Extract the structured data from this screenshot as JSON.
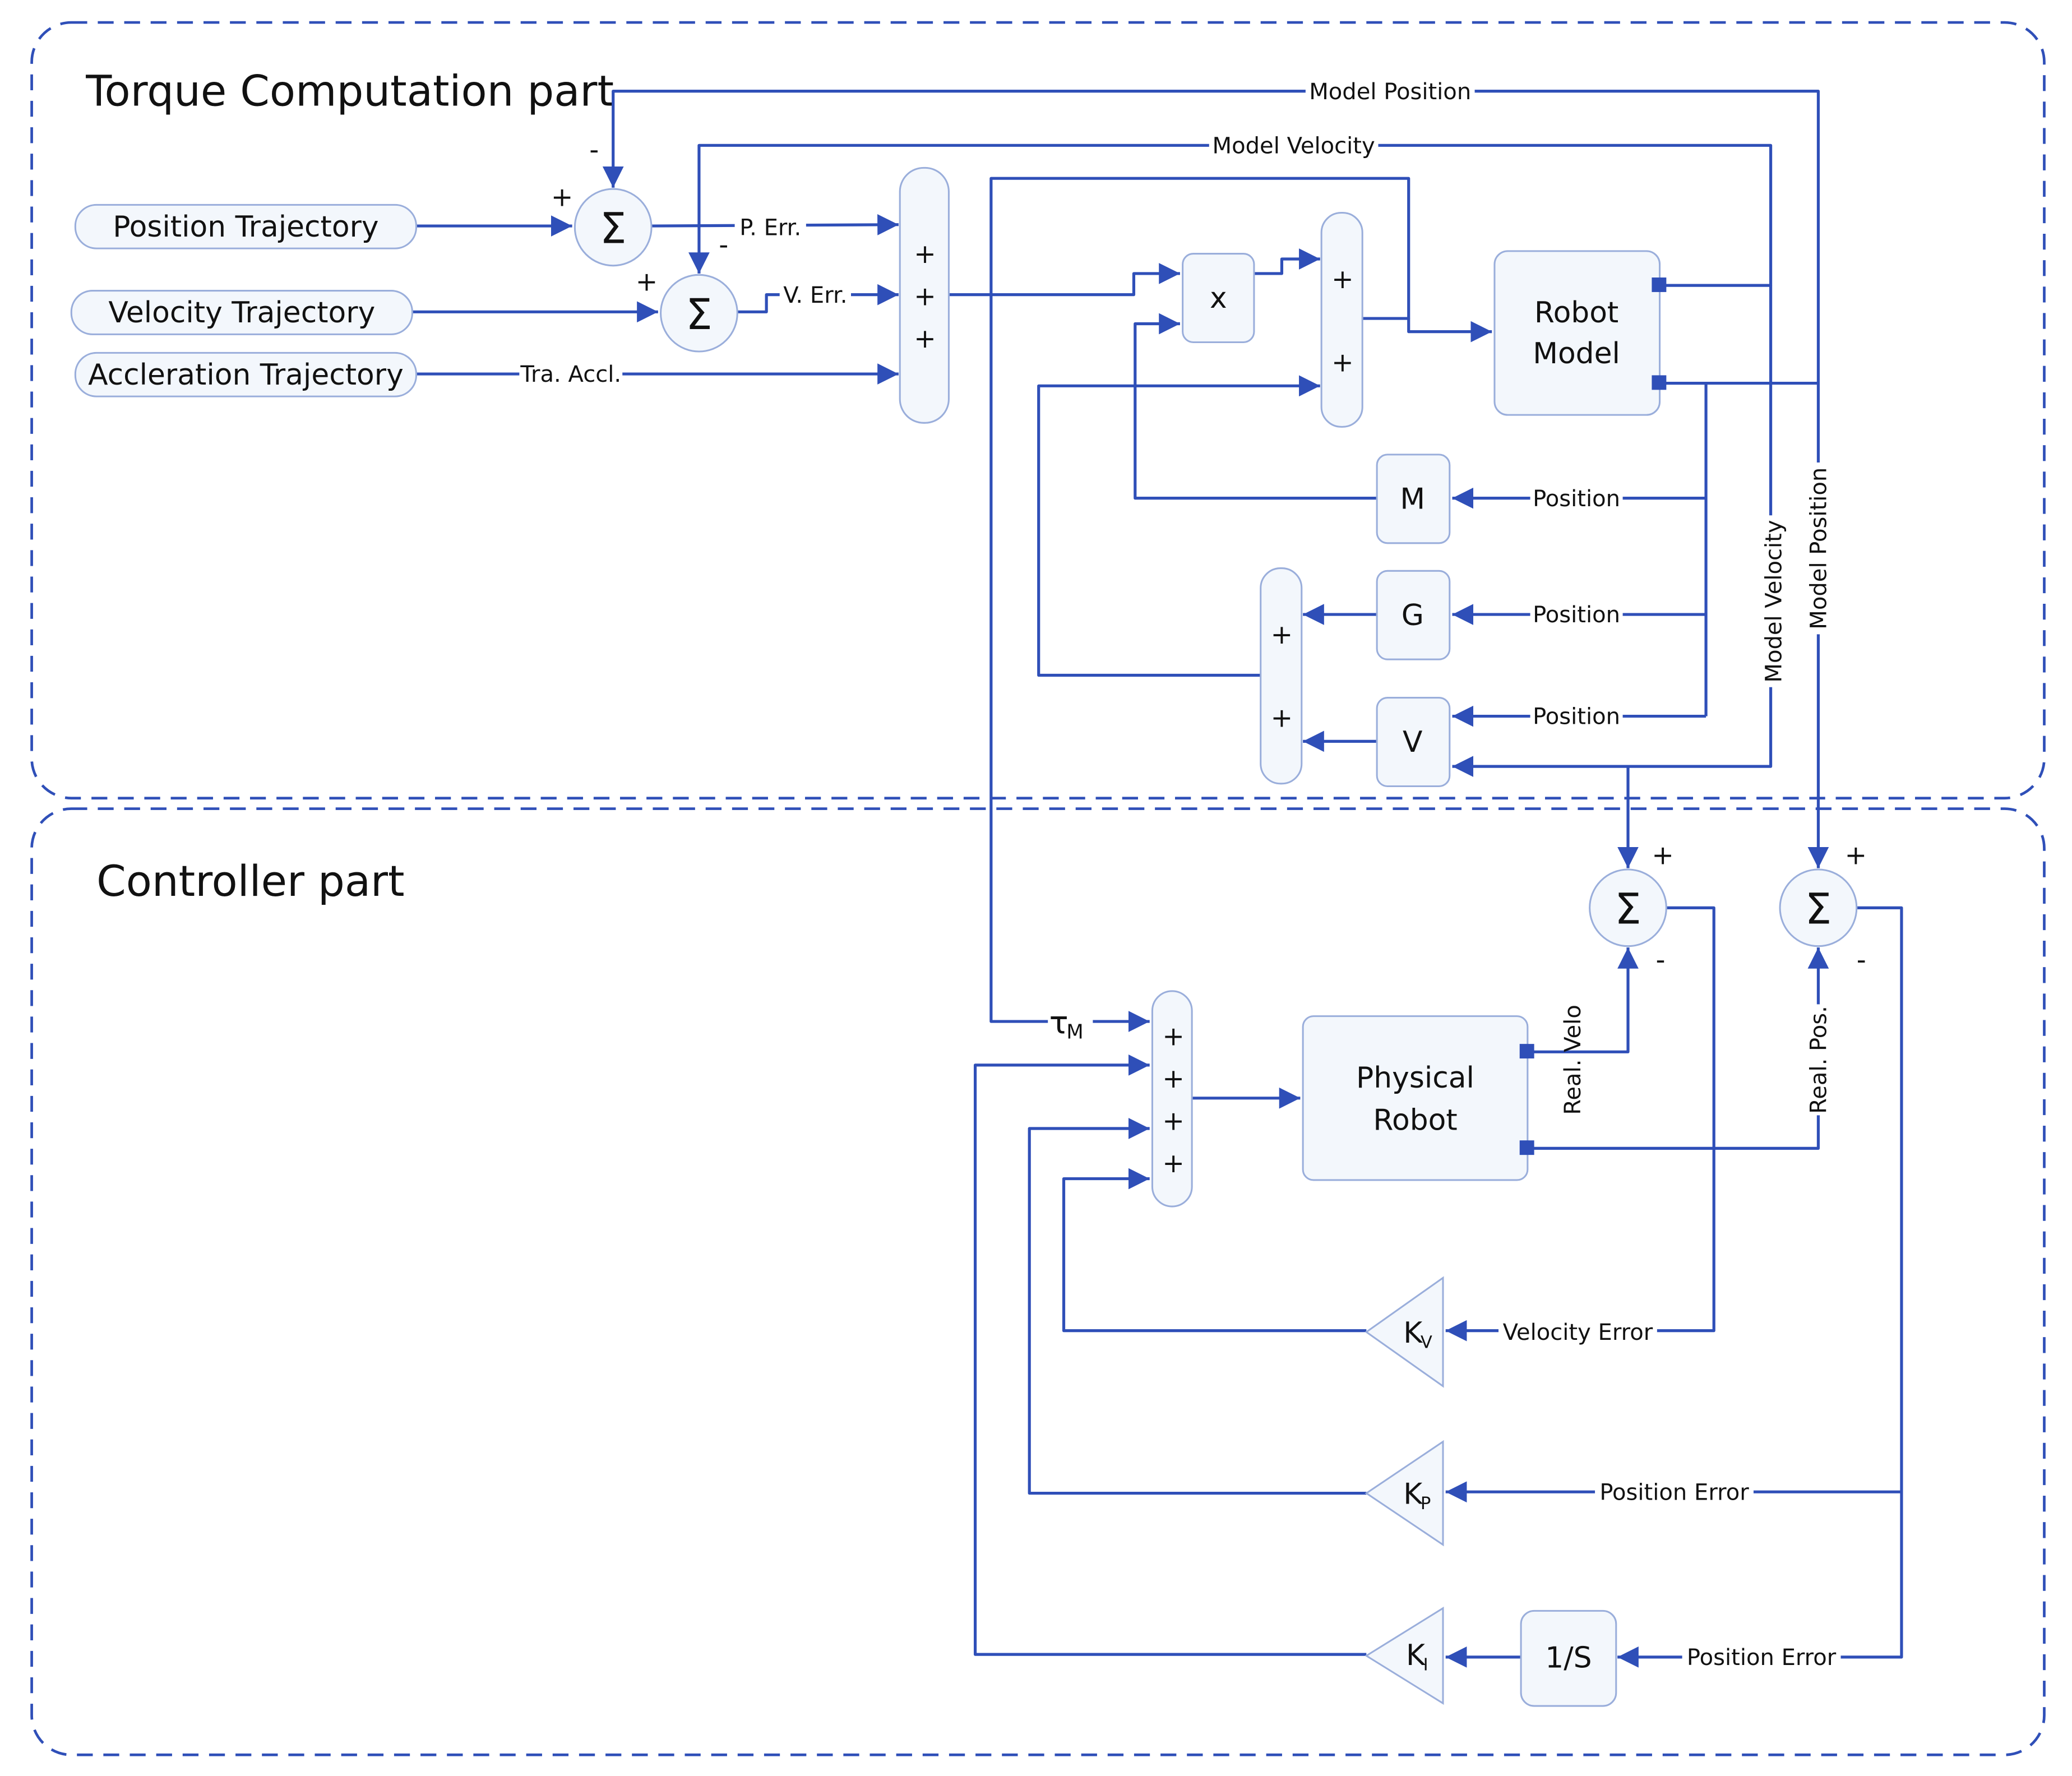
{
  "colors": {
    "line": "#2f4fb8",
    "block_fill": "#f3f7fc",
    "block_stroke": "#9aaedb"
  },
  "groups": {
    "torque_title": "Torque Computation part",
    "controller_title": "Controller part"
  },
  "inputs": {
    "position": "Position Trajectory",
    "velocity": "Velocity Trajectory",
    "acceleration": "Accleration Trajectory"
  },
  "blocks": {
    "sum_symbol": "Σ",
    "multiply": "x",
    "robot_model_1": "Robot",
    "robot_model_2": "Model",
    "m": "M",
    "g": "G",
    "v": "V",
    "physical_robot_1": "Physical",
    "physical_robot_2": "Robot",
    "kv": "K",
    "kv_sub": "V",
    "kp": "K",
    "kp_sub": "P",
    "ki": "K",
    "ki_sub": "I",
    "integrator": "1/S",
    "plus": "+",
    "minus": "-"
  },
  "signals": {
    "model_position": "Model Position",
    "model_velocity": "Model Velocity",
    "p_err": "P. Err.",
    "v_err": "V. Err.",
    "tra_accl": "Tra. Accl.",
    "position": "Position",
    "tau": "τ",
    "tau_sub": "M",
    "real_velo": "Real. Velo",
    "real_pos": "Real. Pos.",
    "velocity_error": "Velocity Error",
    "position_error": "Position Error"
  }
}
